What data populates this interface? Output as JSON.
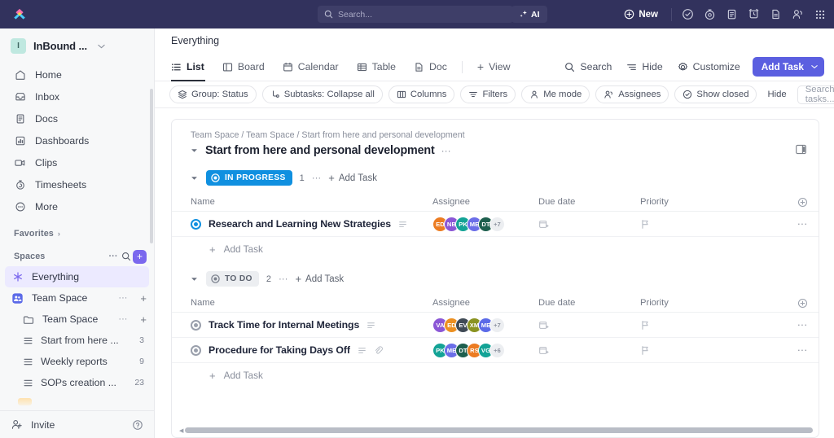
{
  "topbar": {
    "logo_name": "clickup-logo",
    "search_placeholder": "Search...",
    "ai_label": "AI",
    "new_label": "New",
    "icons": [
      "check-circle-icon",
      "stopwatch-icon",
      "clipboard-icon",
      "alarm-icon",
      "document-icon",
      "people-icon",
      "apps-grid-icon"
    ]
  },
  "sidebar": {
    "workspace": {
      "initial": "I",
      "name": "InBound ...",
      "caret": "⌄"
    },
    "nav_items": [
      {
        "label": "Home",
        "icon": "home-icon"
      },
      {
        "label": "Inbox",
        "icon": "inbox-icon"
      },
      {
        "label": "Docs",
        "icon": "docs-icon"
      },
      {
        "label": "Dashboards",
        "icon": "dashboards-icon"
      },
      {
        "label": "Clips",
        "icon": "clips-icon"
      },
      {
        "label": "Timesheets",
        "icon": "timesheets-icon"
      },
      {
        "label": "More",
        "icon": "more-icon"
      }
    ],
    "favorites_label": "Favorites",
    "spaces_label": "Spaces",
    "spaces": {
      "everything": "Everything",
      "team_space": "Team Space",
      "team_space_folder": "Team Space",
      "lists": [
        {
          "label": "Start from here ...",
          "count": "3"
        },
        {
          "label": "Weekly reports",
          "count": "9"
        },
        {
          "label": "SOPs creation ...",
          "count": "23"
        }
      ]
    },
    "invite_label": "Invite"
  },
  "header": {
    "breadcrumb_title": "Everything"
  },
  "view_tabs": [
    {
      "label": "List",
      "icon": "list-icon",
      "active": true
    },
    {
      "label": "Board",
      "icon": "board-icon",
      "active": false
    },
    {
      "label": "Calendar",
      "icon": "calendar-icon",
      "active": false
    },
    {
      "label": "Table",
      "icon": "table-icon",
      "active": false
    },
    {
      "label": "Doc",
      "icon": "doc-icon",
      "active": false
    }
  ],
  "view_add": "View",
  "view_actions": {
    "search": "Search",
    "hide": "Hide",
    "customize": "Customize",
    "add_task": "Add Task"
  },
  "filters": {
    "chips": [
      {
        "label": "Group: Status",
        "icon": "layers-icon"
      },
      {
        "label": "Subtasks: Collapse all",
        "icon": "subtask-icon"
      },
      {
        "label": "Columns",
        "icon": "columns-icon"
      },
      {
        "label": "Filters",
        "icon": "filter-icon"
      },
      {
        "label": "Me mode",
        "icon": "person-icon"
      },
      {
        "label": "Assignees",
        "icon": "assignees-icon"
      },
      {
        "label": "Show closed",
        "icon": "check-circle-icon"
      }
    ],
    "hide_label": "Hide",
    "search_placeholder": "Search tasks..."
  },
  "list_panel": {
    "breadcrumb": "Team Space / Team Space / Start from here and personal development",
    "title": "Start from here and personal development",
    "panel_icon": "sidebar-panel-icon",
    "columns": {
      "name": "Name",
      "assignee": "Assignee",
      "due": "Due date",
      "priority": "Priority"
    },
    "add_task_label": "Add Task",
    "groups": [
      {
        "status": "IN PROGRESS",
        "status_style": "inprog",
        "count": "1",
        "add_task": "Add Task",
        "tasks": [
          {
            "name": "Research and Learning New Strategies",
            "status_dot": "blue",
            "has_description": true,
            "has_attachment": false,
            "avatars": [
              {
                "initials": "ED",
                "color": "#ec7c22"
              },
              {
                "initials": "NB",
                "color": "#8b57d6"
              },
              {
                "initials": "PK",
                "color": "#13a396"
              },
              {
                "initials": "ME",
                "color": "#6b6ee8"
              },
              {
                "initials": "DT",
                "color": "#1e5f4e"
              }
            ],
            "overflow": "+7"
          }
        ]
      },
      {
        "status": "TO DO",
        "status_style": "todo",
        "count": "2",
        "add_task": "Add Task",
        "tasks": [
          {
            "name": "Track Time for Internal Meetings",
            "status_dot": "grey",
            "has_description": true,
            "has_attachment": false,
            "avatars": [
              {
                "initials": "VA",
                "color": "#8b57d6"
              },
              {
                "initials": "ED",
                "color": "#ec9022"
              },
              {
                "initials": "EV",
                "color": "#3f4a55"
              },
              {
                "initials": "XM",
                "color": "#8a9321"
              },
              {
                "initials": "ME",
                "color": "#5b6ae8"
              }
            ],
            "overflow": "+7"
          },
          {
            "name": "Procedure for Taking Days Off",
            "status_dot": "grey",
            "has_description": true,
            "has_attachment": true,
            "avatars": [
              {
                "initials": "PK",
                "color": "#13a396"
              },
              {
                "initials": "ME",
                "color": "#6b6ee8"
              },
              {
                "initials": "DT",
                "color": "#1e5f4e"
              },
              {
                "initials": "RS",
                "color": "#ec7c22"
              },
              {
                "initials": "VG",
                "color": "#13a396"
              }
            ],
            "overflow": "+6"
          }
        ]
      }
    ]
  },
  "colors": {
    "topbar_bg": "#32325d",
    "accent_purple": "#7b68ee",
    "add_task_blue": "#5b5fe0",
    "in_progress_blue": "#1090e0",
    "sidebar_bg": "#f7f8f9"
  }
}
